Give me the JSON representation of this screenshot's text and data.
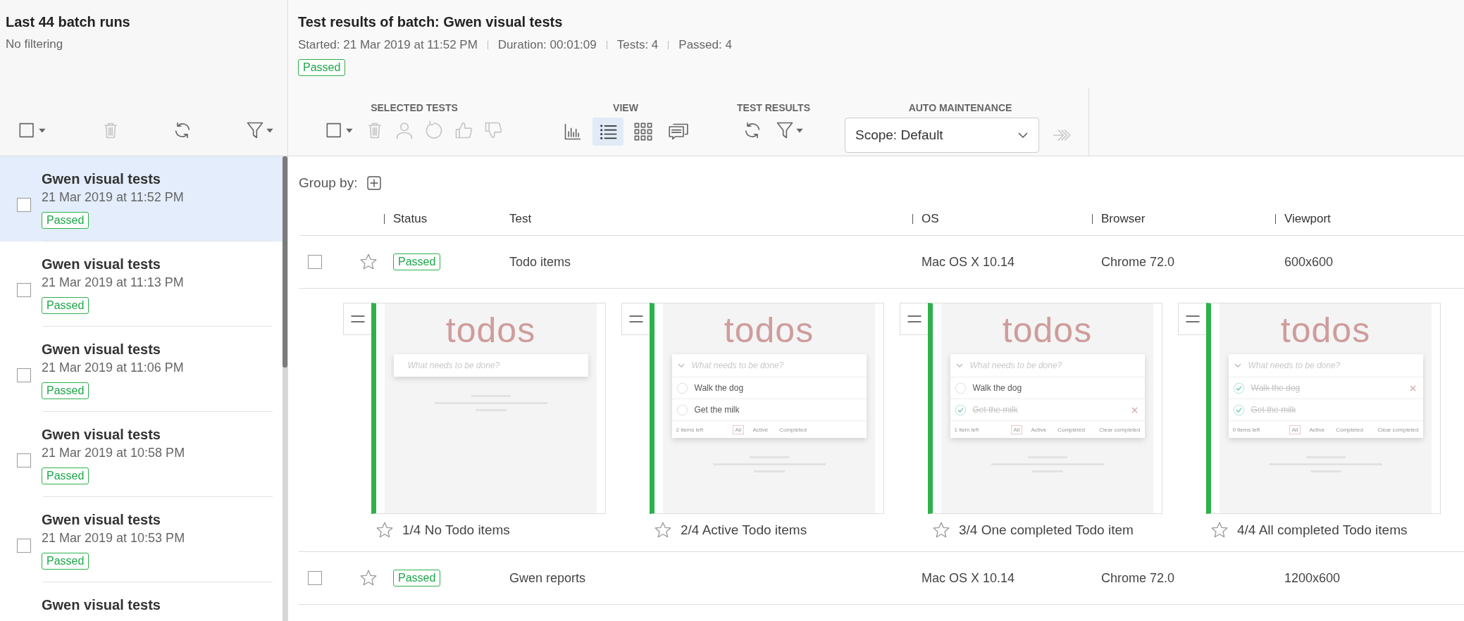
{
  "batches_panel": {
    "title": "Last 44 batch runs",
    "subtitle": "No filtering",
    "toolbar": [
      {
        "kind": "select",
        "disabled": false
      },
      {
        "kind": "trash",
        "disabled": true
      },
      {
        "kind": "refresh",
        "disabled": false
      },
      {
        "kind": "filter",
        "disabled": false
      }
    ],
    "batches": [
      {
        "name": "Gwen visual tests",
        "date": "21 Mar 2019 at 11:52 PM",
        "status": "Passed",
        "selected": true,
        "checked": false
      },
      {
        "name": "Gwen visual tests",
        "date": "21 Mar 2019 at 11:13 PM",
        "status": "Passed",
        "selected": false,
        "checked": false
      },
      {
        "name": "Gwen visual tests",
        "date": "21 Mar 2019 at 11:06 PM",
        "status": "Passed",
        "selected": false,
        "checked": false
      },
      {
        "name": "Gwen visual tests",
        "date": "21 Mar 2019 at 10:58 PM",
        "status": "Passed",
        "selected": false,
        "checked": false
      },
      {
        "name": "Gwen visual tests",
        "date": "21 Mar 2019 at 10:53 PM",
        "status": "Passed",
        "selected": false,
        "checked": false
      },
      {
        "name": "Gwen visual tests",
        "selected": false
      }
    ]
  },
  "batch": {
    "title": "Test results of batch: Gwen visual tests",
    "meta": [
      "Started: 21 Mar 2019 at 11:52 PM",
      "Duration: 00:01:09",
      "Tests: 4",
      "Passed: 4"
    ],
    "status": "Passed",
    "toolbar_groups": [
      {
        "label": "SELECTED TESTS",
        "items": [
          {
            "kind": "select",
            "disabled": false,
            "selected": false
          },
          {
            "kind": "trash",
            "disabled": true,
            "selected": false
          },
          {
            "kind": "person",
            "disabled": true,
            "selected": false
          },
          {
            "kind": "undo",
            "disabled": true,
            "selected": false
          },
          {
            "kind": "thumbs-up",
            "disabled": true,
            "selected": false
          },
          {
            "kind": "thumbs-down",
            "disabled": true,
            "selected": false
          }
        ]
      },
      {
        "label": "VIEW",
        "items": [
          {
            "kind": "chart",
            "disabled": false,
            "selected": false
          },
          {
            "kind": "list",
            "disabled": false,
            "selected": true
          },
          {
            "kind": "grid",
            "disabled": false,
            "selected": false
          },
          {
            "kind": "comments",
            "disabled": false,
            "selected": false
          }
        ]
      },
      {
        "label": "TEST RESULTS",
        "items": [
          {
            "kind": "refresh",
            "disabled": false,
            "selected": false
          },
          {
            "kind": "filter",
            "disabled": false,
            "selected": false
          }
        ]
      },
      {
        "label": "AUTO MAINTENANCE",
        "scope": "Scope: Default",
        "items": [
          {
            "kind": "merge",
            "disabled": true,
            "selected": false
          }
        ]
      }
    ]
  },
  "group_by": {
    "label": "Group by:"
  },
  "table": {
    "columns": [
      "Status",
      "Test",
      "OS",
      "Browser",
      "Viewport"
    ],
    "rows": [
      {
        "checked": false,
        "starred": false,
        "status": "Passed",
        "test": "Todo items",
        "os": "Mac OS X 10.14",
        "browser": "Chrome 72.0",
        "viewport": "600x600",
        "steps": [
          {
            "caption": "1/4 No Todo items",
            "starred": false,
            "app": {
              "logo": "todos",
              "placeholder": "What needs to be done?"
            }
          },
          {
            "caption": "2/4 Active Todo items",
            "starred": false,
            "app": {
              "logo": "todos",
              "placeholder": "What needs to be done?",
              "items": [
                {
                  "text": "Walk the dog",
                  "completed": false
                },
                {
                  "text": "Get the milk",
                  "completed": false
                }
              ],
              "footer": {
                "count": "2 items left",
                "filters": [
                  {
                    "label": "All",
                    "selected": true
                  },
                  {
                    "label": "Active",
                    "selected": false
                  },
                  {
                    "label": "Completed",
                    "selected": false
                  }
                ]
              }
            }
          },
          {
            "caption": "3/4 One completed Todo item",
            "starred": false,
            "app": {
              "logo": "todos",
              "placeholder": "What needs to be done?",
              "items": [
                {
                  "text": "Walk the dog",
                  "completed": false
                },
                {
                  "text": "Get the milk",
                  "completed": true
                }
              ],
              "footer": {
                "count": "1 item left",
                "filters": [
                  {
                    "label": "All",
                    "selected": true
                  },
                  {
                    "label": "Active",
                    "selected": false
                  },
                  {
                    "label": "Completed",
                    "selected": false
                  }
                ],
                "clear": "Clear completed"
              }
            }
          },
          {
            "caption": "4/4 All completed Todo items",
            "starred": false,
            "app": {
              "logo": "todos",
              "placeholder": "What needs to be done?",
              "items": [
                {
                  "text": "Walk the dog",
                  "completed": true
                },
                {
                  "text": "Get the milk",
                  "completed": true
                }
              ],
              "footer": {
                "count": "0 items left",
                "filters": [
                  {
                    "label": "All",
                    "selected": true
                  },
                  {
                    "label": "Active",
                    "selected": false
                  },
                  {
                    "label": "Completed",
                    "selected": false
                  }
                ],
                "clear": "Clear completed"
              }
            }
          }
        ]
      },
      {
        "checked": false,
        "starred": false,
        "status": "Passed",
        "test": "Gwen reports",
        "os": "Mac OS X 10.14",
        "browser": "Chrome 72.0",
        "viewport": "1200x600"
      }
    ]
  }
}
